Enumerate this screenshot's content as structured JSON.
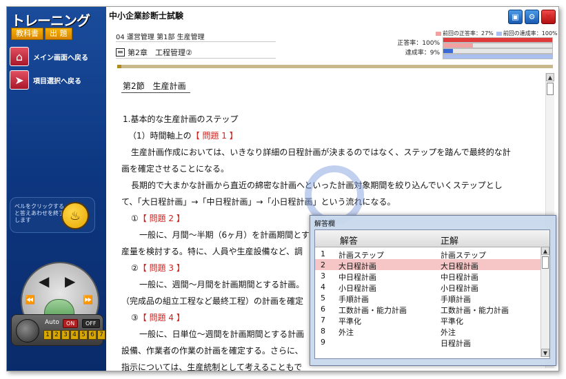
{
  "sidebar": {
    "logo": "トレーニング",
    "tabs": [
      "教科書",
      "出 題"
    ],
    "nav": [
      {
        "label": "メイン画面へ戻る",
        "icon": "house-icon"
      },
      {
        "label": "項目選択へ戻る",
        "icon": "pointer-icon"
      }
    ],
    "bell_text": "ベルをクリックすると答えあわせを終了します",
    "auto_label": "Auto",
    "on_label": "ON",
    "off_label": "OFF",
    "digits": [
      "1",
      "2",
      "3",
      "4",
      "5",
      "6",
      "7"
    ]
  },
  "header": {
    "title": "中小企業診断士試験",
    "breadcrumb": "04 運営管理 第1部 生産管理",
    "chapter": "第2章　工程管理②"
  },
  "stats": {
    "legend_prev_correct": "前回の正答率：",
    "legend_prev_correct_value": "27%",
    "legend_prev_progress": "前回の達成率：",
    "legend_prev_progress_value": "100%",
    "correct_label": "正答率：",
    "correct_value": "100%",
    "progress_label": "達成率：",
    "progress_value": "9%",
    "correct_fraction": 1.0,
    "prev_correct_fraction": 0.27,
    "progress_fraction": 0.09,
    "prev_progress_fraction": 1.0,
    "colors": {
      "correct": "#e03a3a",
      "progress": "#3a6ad8",
      "prev_correct": "#f3a0a0",
      "prev_progress": "#a8bff0"
    }
  },
  "content": {
    "section": "第2節　生産計画",
    "lines": [
      "1.基本的な生産計画のステップ",
      "（1）時間軸上の",
      "【 問題 1 】",
      "生産計画作成においては、いきなり詳細の日程計画が決まるのではなく、ステップを踏んで最終的な計",
      "画を確定させることになる。",
      "長期的で大まかな計画から直近の綿密な計画へといった計画対象期間を絞り込んでいくステップとし",
      "て、「大日程計画」→「中日程計画」→「小日程計画」という流れになる。",
      "①",
      "【 問題 2 】",
      "一般に、月間～半期（6ヶ月）を計画期間とす",
      "産量を検討する。特に、人員や生産設備など、調",
      "②",
      "【 問題 3 】",
      "一般に、週間～月間を計画期間とする計画。",
      "（完成品の組立工程など最終工程）の計画を確定",
      "③",
      "【 問題 4 】",
      "一般に、日単位～週間を計画期間とする計画",
      "設備、作業者の作業の計画を確定する。さらに、",
      "指示については、生産統制として考えることもで"
    ]
  },
  "answer_panel": {
    "title": "解答欄",
    "col_answer": "解答",
    "col_correct": "正解",
    "rows": [
      {
        "no": "1",
        "answer": "計画ステップ",
        "correct": "計画ステップ"
      },
      {
        "no": "2",
        "answer": "大日程計画",
        "correct": "大日程計画"
      },
      {
        "no": "3",
        "answer": "中日程計画",
        "correct": "中日程計画"
      },
      {
        "no": "4",
        "answer": "小日程計画",
        "correct": "小日程計画"
      },
      {
        "no": "5",
        "answer": "手順計画",
        "correct": "手順計画"
      },
      {
        "no": "6",
        "answer": "工数計画・能力計画",
        "correct": "工数計画・能力計画"
      },
      {
        "no": "7",
        "answer": "平準化",
        "correct": "平準化"
      },
      {
        "no": "8",
        "answer": "外注",
        "correct": "外注"
      },
      {
        "no": "9",
        "answer": "",
        "correct": "日程計画"
      }
    ],
    "selected_row": 1
  }
}
